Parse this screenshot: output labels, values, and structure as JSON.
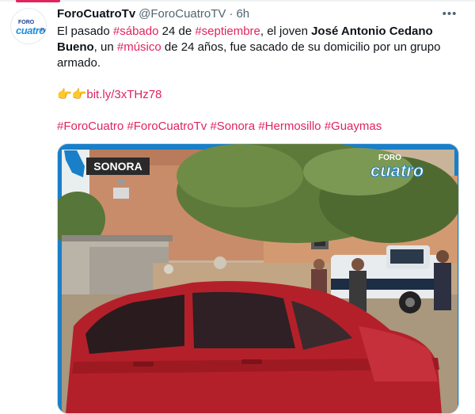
{
  "tweet": {
    "display_name": "ForoCuatroTv",
    "handle": "@ForoCuatroTV",
    "separator": "·",
    "time": "6h",
    "more_label": "•••",
    "text": {
      "l1_a": "El pasado ",
      "l1_tag1": "#sábado",
      "l1_b": " 24 de ",
      "l1_tag2": "#septiembre",
      "l1_c": ", el joven ",
      "name": "José Antonio Cedano Bueno",
      "l2_a": ", un ",
      "l2_tag": "#músico",
      "l2_b": " de 24 años, fue sacado de su domicilio por un grupo armado.",
      "link_emoji": "👉👉",
      "link": "bit.ly/3xTHz78",
      "hashtags": [
        "#ForoCuatro",
        "#ForoCuatroTv",
        "#Sonora",
        "#Hermosillo",
        "#Guaymas"
      ]
    }
  },
  "avatar": {
    "logo_top": "FORO",
    "logo_main": "cuatro",
    "logo_tv": "TV"
  },
  "media": {
    "badge_label": "SONORA",
    "logo_top": "FORO",
    "logo_main": "cuatro"
  },
  "colors": {
    "accent": "#e0245e",
    "text": "#0f1419",
    "muted": "#536471",
    "brand_blue": "#1d8fe0"
  }
}
